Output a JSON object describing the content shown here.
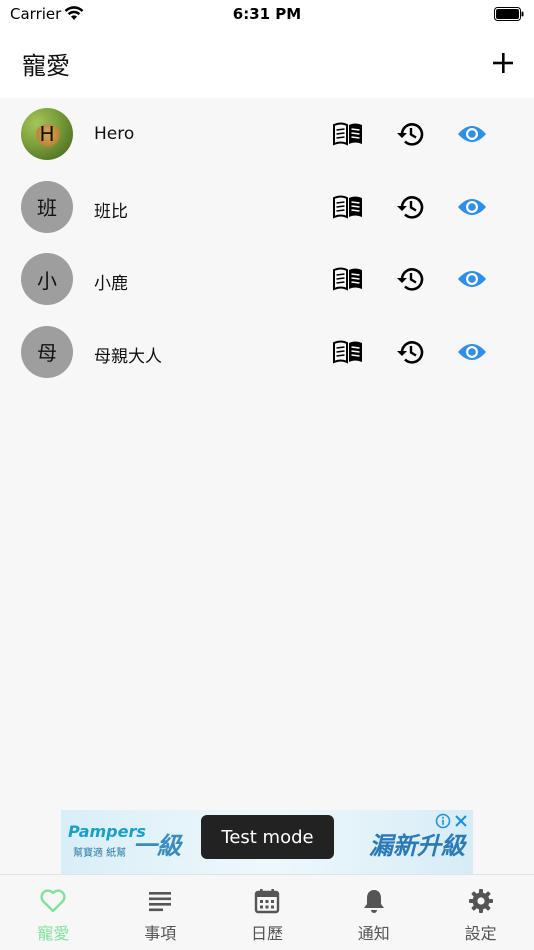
{
  "status_bar": {
    "carrier": "Carrier",
    "time": "6:31 PM"
  },
  "header": {
    "title": "寵愛",
    "add_icon": "plus-icon"
  },
  "pets": [
    {
      "name": "Hero",
      "avatar_letter": "H",
      "avatar_type": "photo"
    },
    {
      "name": "班比",
      "avatar_letter": "班",
      "avatar_type": "letter"
    },
    {
      "name": "小鹿",
      "avatar_letter": "小",
      "avatar_type": "letter"
    },
    {
      "name": "母親大人",
      "avatar_letter": "母",
      "avatar_type": "letter"
    }
  ],
  "row_actions": {
    "book_icon": "book-icon",
    "history_icon": "history-icon",
    "eye_icon": "eye-icon"
  },
  "colors": {
    "accent": "#7fe39a",
    "eye": "#2e8fe6",
    "avatar_bg": "#9e9e9e"
  },
  "ad": {
    "brand": "Pampers",
    "brand_sub": "幫寶適 紙幫",
    "headline_left": "一級",
    "headline_right": "漏新升級",
    "badge": "Test mode"
  },
  "tabs": [
    {
      "label": "寵愛",
      "icon": "heart-icon",
      "active": true
    },
    {
      "label": "事項",
      "icon": "list-icon",
      "active": false
    },
    {
      "label": "日歷",
      "icon": "calendar-icon",
      "active": false
    },
    {
      "label": "通知",
      "icon": "bell-icon",
      "active": false
    },
    {
      "label": "設定",
      "icon": "gear-icon",
      "active": false
    }
  ]
}
